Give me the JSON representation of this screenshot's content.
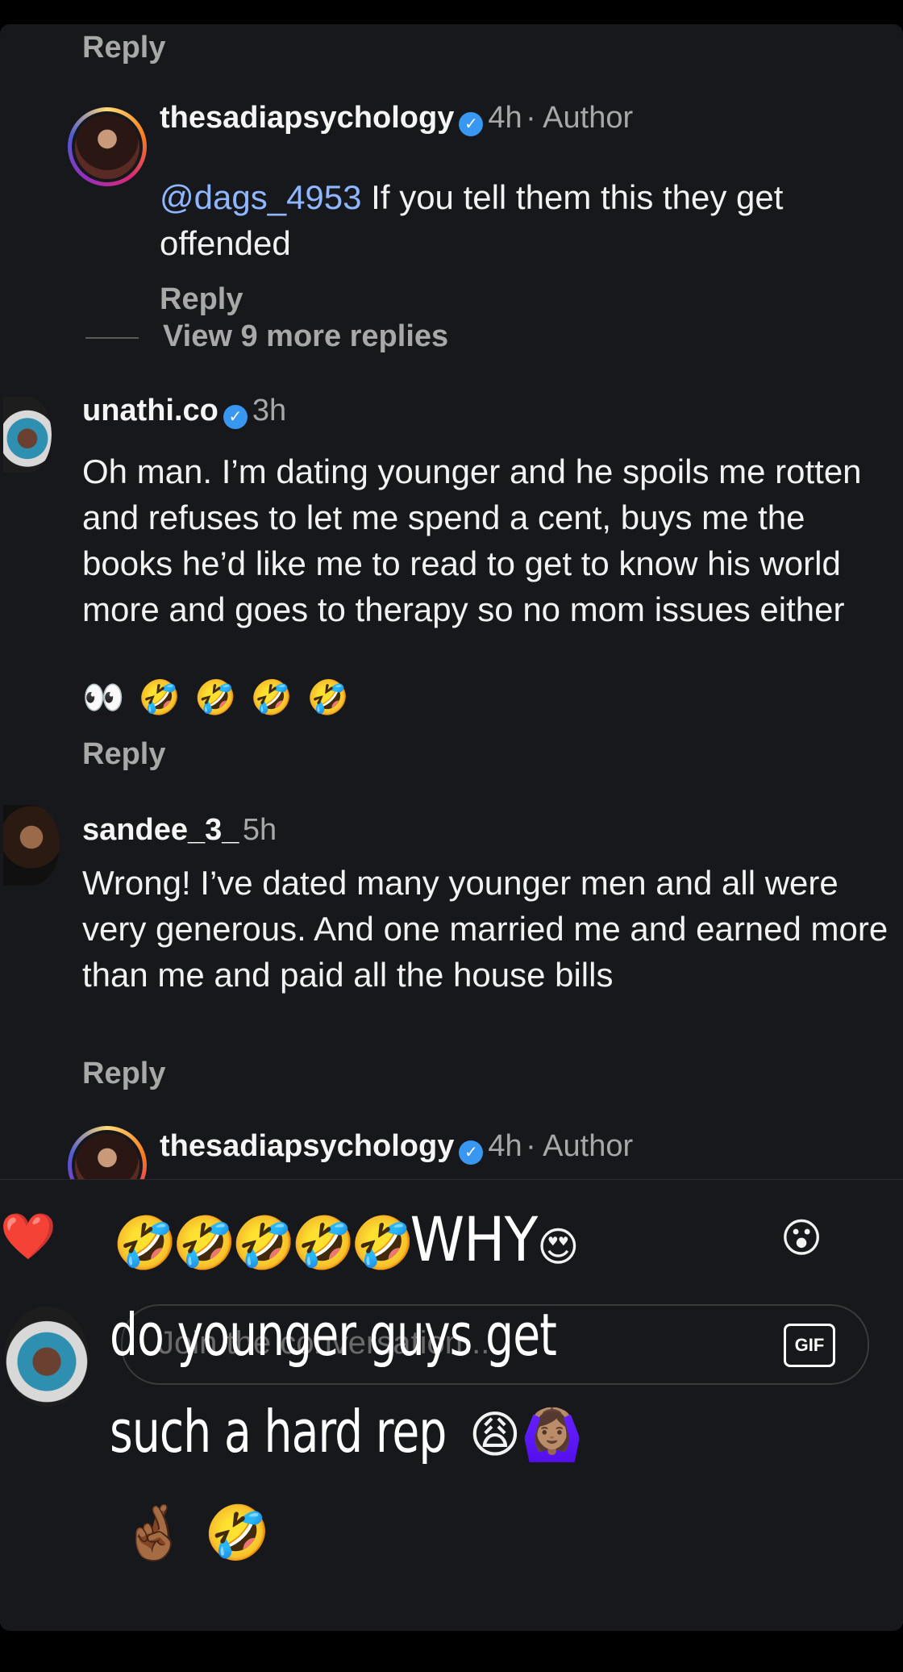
{
  "top_reply": "Reply",
  "comments": [
    {
      "username": "thesadiapsychology",
      "time": "4h",
      "tag": "· Author",
      "mention": "@dags_4953",
      "text": " If you tell them this they get offended",
      "reply": "Reply"
    },
    {
      "username": "unathi.co",
      "time": "3h",
      "text": "Oh man. I’m dating younger and he spoils me rotten and refuses to let me spend a cent, buys me the books he’d like me to read to get to know his world more and goes to therapy so no mom issues either",
      "emojis": "👀 🤣 🤣 🤣 🤣",
      "reply": "Reply"
    },
    {
      "username": "sandee_3_",
      "time": "5h",
      "text": "Wrong! I’ve dated many younger men and all were very generous. And one married me and earned more than me and paid all the house bills",
      "reply": "Reply"
    },
    {
      "username": "thesadiapsychology",
      "time": "4h",
      "tag": "· Author"
    }
  ],
  "view_more": "View 9 more replies",
  "reactions": {
    "heart": "❤️",
    "surprised": "😮"
  },
  "composer": {
    "placeholder": "Join the conversation...",
    "gif_label": "GIF"
  },
  "overlay": {
    "line1_emojis": "🤣🤣🤣🤣🤣",
    "line1_word": "WHY",
    "line1_end": "😍",
    "line2": "do younger guys get",
    "line3": "such a hard rep",
    "line3_emojis": "😩🙆🏽‍♀️",
    "line4_emojis": "🤞🏾 🤣"
  }
}
